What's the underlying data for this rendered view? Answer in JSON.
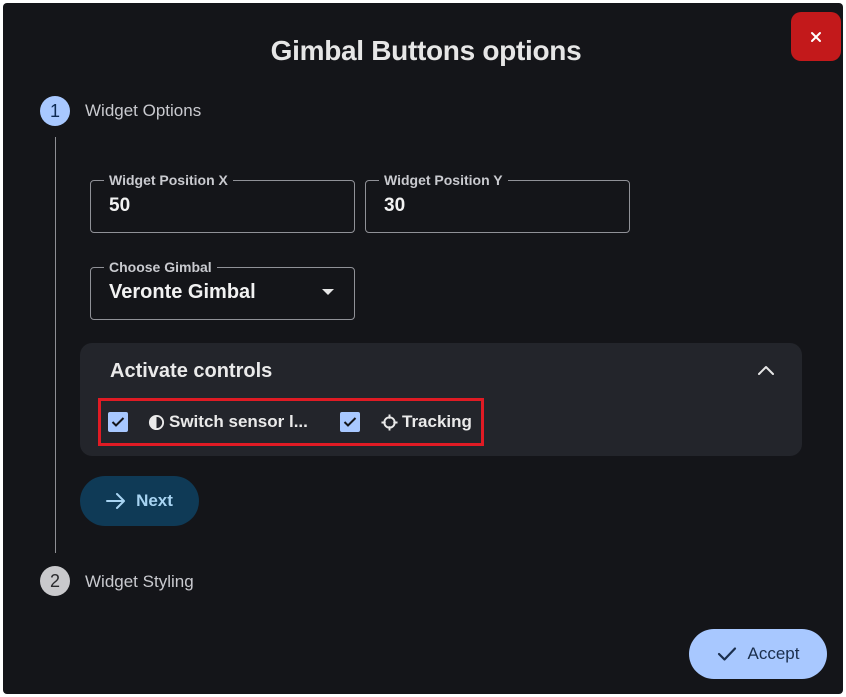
{
  "dialog": {
    "title": "Gimbal Buttons options"
  },
  "stepper": {
    "steps": [
      {
        "number": "1",
        "label": "Widget Options"
      },
      {
        "number": "2",
        "label": "Widget Styling"
      }
    ]
  },
  "fields": {
    "position_x": {
      "label": "Widget Position X",
      "value": "50"
    },
    "position_y": {
      "label": "Widget Position Y",
      "value": "30"
    },
    "gimbal": {
      "label": "Choose Gimbal",
      "value": "Veronte Gimbal"
    }
  },
  "controls_panel": {
    "title": "Activate controls",
    "expanded": true,
    "options": [
      {
        "label": "Switch sensor l...",
        "checked": true,
        "icon": "contrast-icon"
      },
      {
        "label": "Tracking",
        "checked": true,
        "icon": "crosshair-icon"
      }
    ]
  },
  "buttons": {
    "next": "Next",
    "accept": "Accept"
  },
  "colors": {
    "background": "#141519",
    "accent": "#a8c8ff",
    "close": "#c3191b",
    "highlight": "#e01b24",
    "next_button": "#0f3a56"
  }
}
